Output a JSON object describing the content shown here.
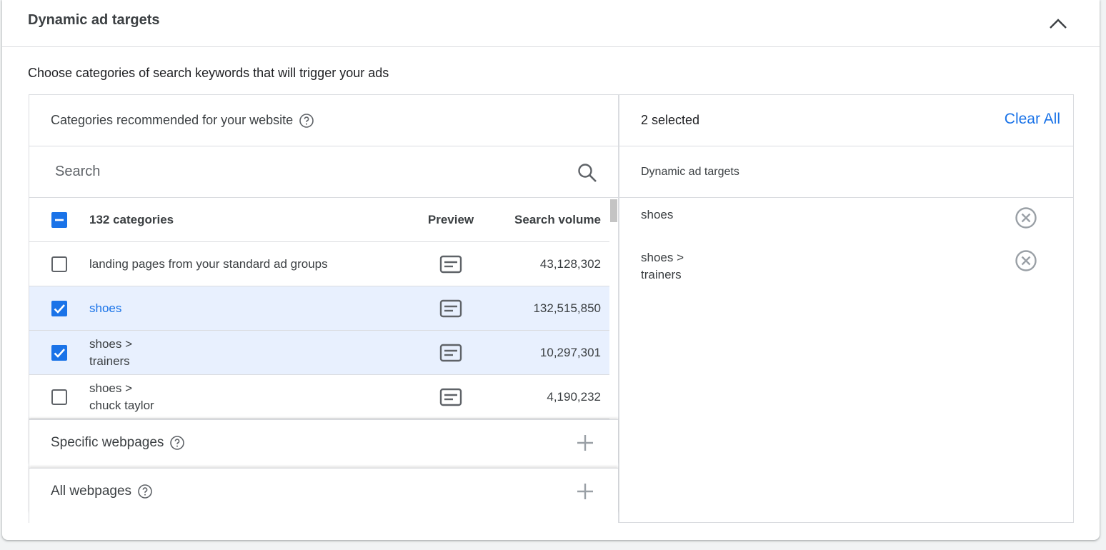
{
  "header": {
    "title": "Dynamic ad targets"
  },
  "intro": "Choose categories of search keywords that will trigger your ads",
  "left": {
    "heading": "Categories recommended for your website",
    "search_placeholder": "Search",
    "table": {
      "count_label": "132 categories",
      "preview_label": "Preview",
      "volume_label": "Search volume",
      "rows": [
        {
          "name_line1": "landing pages from your standard ad groups",
          "name_line2": "",
          "volume": "43,128,302",
          "selected": false
        },
        {
          "name_line1": "shoes",
          "name_line2": "",
          "volume": "132,515,850",
          "selected": true
        },
        {
          "name_line1": "shoes >",
          "name_line2": "trainers",
          "volume": "10,297,301",
          "selected": true
        },
        {
          "name_line1": "shoes >",
          "name_line2": "chuck taylor",
          "volume": "4,190,232",
          "selected": false
        }
      ]
    },
    "sections": [
      {
        "label": "Specific webpages"
      },
      {
        "label": "All webpages"
      }
    ]
  },
  "right": {
    "selected_count": "2 selected",
    "clear_all": "Clear All",
    "subheading": "Dynamic ad targets",
    "items": [
      {
        "line1": "shoes",
        "line2": ""
      },
      {
        "line1": "shoes >",
        "line2": "trainers"
      }
    ]
  },
  "colors": {
    "accent": "#1a73e8",
    "selected_row": "#e8f0fe",
    "border": "#dadce0"
  }
}
